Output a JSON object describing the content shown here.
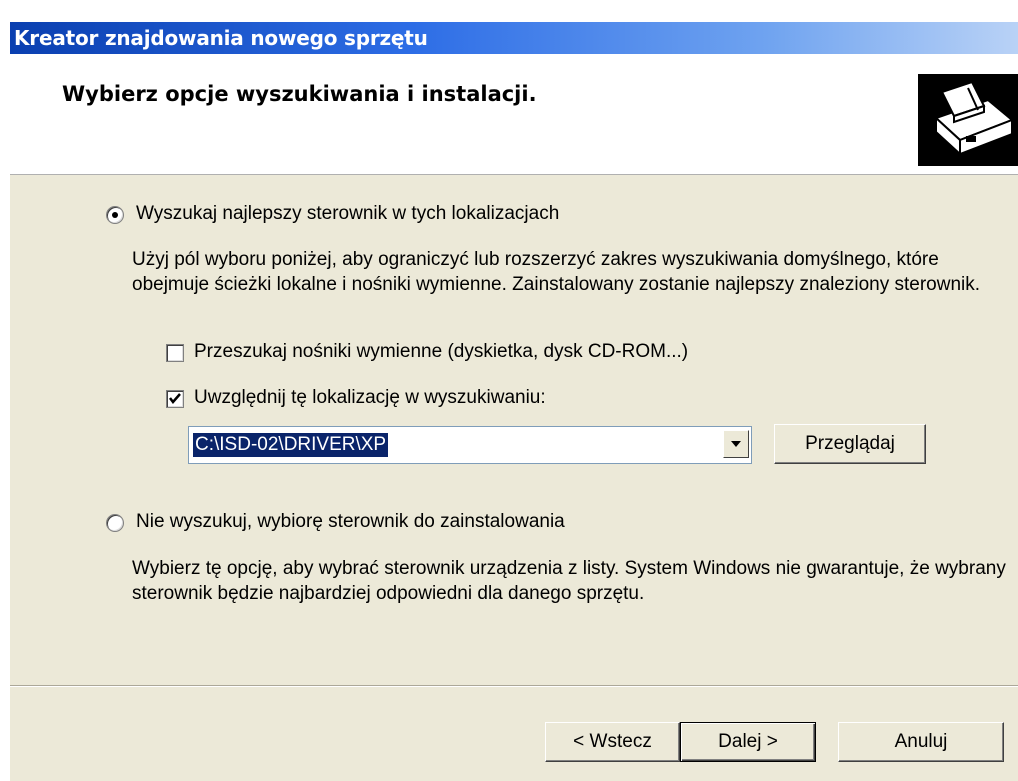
{
  "window": {
    "title": "Kreator znajdowania nowego sprzętu"
  },
  "header": {
    "heading": "Wybierz opcje wyszukiwania i instalacji.",
    "icon": "hardware-icon"
  },
  "options": {
    "search": {
      "label": "Wyszukaj najlepszy sterownik w tych lokalizacjach",
      "selected": true,
      "description": "Użyj pól wyboru poniżej, aby ograniczyć lub rozszerzyć zakres wyszukiwania domyślnego, które obejmuje ścieżki lokalne i nośniki wymienne. Zainstalowany zostanie najlepszy znaleziony sterownik.",
      "removable_media": {
        "label": "Przeszukaj nośniki wymienne (dyskietka, dysk CD-ROM...)",
        "checked": false
      },
      "include_location": {
        "label": "Uwzględnij tę lokalizację w wyszukiwaniu:",
        "checked": true
      },
      "path_value": "C:\\ISD-02\\DRIVER\\XP",
      "browse_label": "Przeglądaj"
    },
    "manual": {
      "label": "Nie wyszukuj, wybiorę sterownik do zainstalowania",
      "selected": false,
      "description": "Wybierz tę opcję, aby wybrać sterownik urządzenia z listy. System Windows nie gwarantuje, że wybrany sterownik będzie najbardziej odpowiedni dla danego sprzętu."
    }
  },
  "footer": {
    "back_label": "< Wstecz",
    "next_label": "Dalej >",
    "cancel_label": "Anuluj"
  },
  "colors": {
    "face": "#ece9d8",
    "title_start": "#0a3fb0",
    "selection": "#0a246a"
  }
}
